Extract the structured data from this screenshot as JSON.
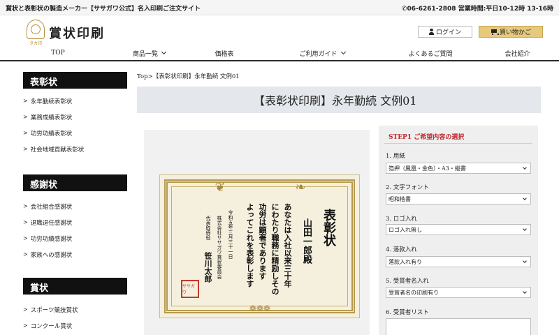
{
  "topbar": {
    "tagline": "賞状と表彰状の製造メーカー【ササガワ公式】名入印刷ご注文サイト",
    "phone": "06-6261-2808 営業時間:平日10-12時 13-16時"
  },
  "header": {
    "logo_text": "賞状印刷",
    "logo_sub": "タカ印",
    "login_label": "ログイン",
    "cart_label": "買い物かご"
  },
  "nav": [
    {
      "label": "TOP"
    },
    {
      "label": "商品一覧"
    },
    {
      "label": "価格表"
    },
    {
      "label": "ご利用ガイド"
    },
    {
      "label": "よくあるご質問"
    },
    {
      "label": "会社紹介"
    }
  ],
  "sidebar": {
    "sections": [
      {
        "heading": "表彰状",
        "items": [
          "永年勤続表彰状",
          "業務成績表彰状",
          "功労功績表彰状",
          "社会地域貢献表彰状"
        ]
      },
      {
        "heading": "感謝状",
        "items": [
          "会社組合感謝状",
          "退職退任感謝状",
          "功労功績感謝状",
          "家族への感謝状"
        ]
      },
      {
        "heading": "賞状",
        "items": [
          "スポーツ競技賞状",
          "コンクール賞状"
        ]
      }
    ]
  },
  "main": {
    "breadcrumb": "Top>【表彰状印刷】永年勤続 文例01",
    "title": "【表彰状印刷】永年勤続 文例01"
  },
  "certificate": {
    "heading": "表彰状",
    "recipient": "山田一郎殿",
    "body_lines": [
      "あなたは入社以来三十年",
      "にわたり職務に精励しその",
      "功労は顕著であります",
      "よってこれを表彰します"
    ],
    "date": "令和五年三月三十一日",
    "company": "株式会社ササガワ賞状委員会",
    "signer_title": "代表取締役",
    "signer": "笹川太郎",
    "seal_text": "ササガワ"
  },
  "step": {
    "title": "STEP1 ご希望内容の選択",
    "fields": [
      {
        "label": "1. 用紙",
        "value": "箔押（鳳凰・金色）・A3・縦書"
      },
      {
        "label": "2. 文字フォント",
        "value": "昭和楷書"
      },
      {
        "label": "3. ロゴ入れ",
        "value": "ロゴ入れ無し"
      },
      {
        "label": "4. 落款入れ",
        "value": "落款入れ有り"
      },
      {
        "label": "5. 受賞者名入れ",
        "value": "受賞者名の印刷有り"
      }
    ],
    "list_label": "6. 受賞者リスト"
  },
  "colors": {
    "accent_red": "#c0282d",
    "gold": "#e7c97d",
    "dark": "#111111"
  }
}
